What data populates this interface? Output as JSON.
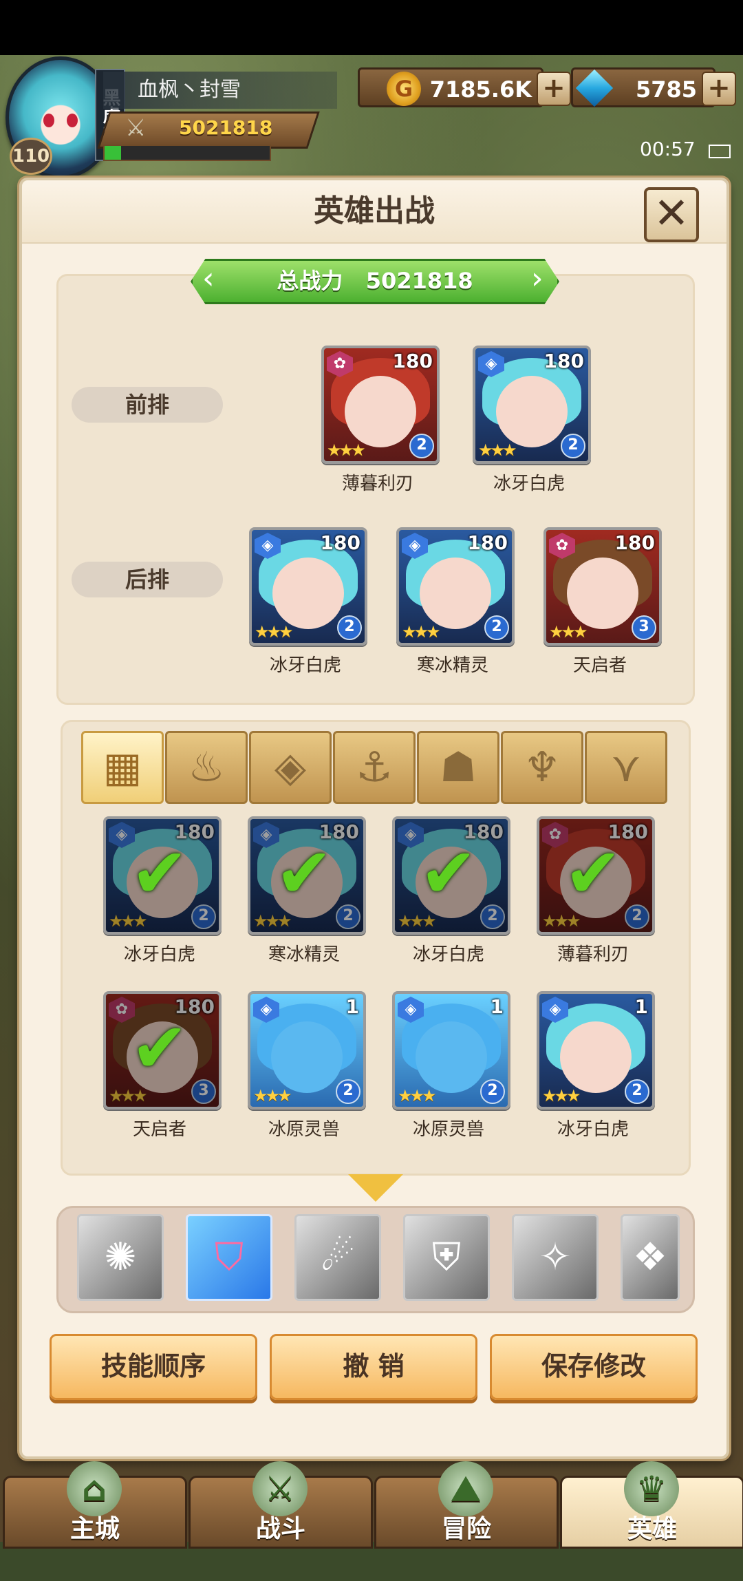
{
  "player": {
    "name": "血枫丶封雪",
    "level": "110",
    "power": "5021818",
    "vip_tag": "黑虎堂",
    "exp_fraction": 0.1
  },
  "currency": {
    "gold": "7185.6K",
    "gems": "5785"
  },
  "clock": "00:57",
  "panel": {
    "title": "英雄出战",
    "close_label": "✕",
    "total_power_label": "总战力",
    "total_power": "5021818",
    "front_row_label": "前排",
    "back_row_label": "后排"
  },
  "front_row": [
    {
      "name": "薄暮利刃",
      "level": "180",
      "rank": "2",
      "faction": "red"
    },
    {
      "name": "冰牙白虎",
      "level": "180",
      "rank": "2",
      "faction": "blue"
    }
  ],
  "back_row": [
    {
      "name": "冰牙白虎",
      "level": "180",
      "rank": "2",
      "faction": "blue"
    },
    {
      "name": "寒冰精灵",
      "level": "180",
      "rank": "2",
      "faction": "blue"
    },
    {
      "name": "天启者",
      "level": "180",
      "rank": "3",
      "faction": "red"
    }
  ],
  "filter_tabs": [
    {
      "icon": "grid-icon",
      "glyph": "▦",
      "active": true
    },
    {
      "icon": "flame-faction-icon",
      "glyph": "♨",
      "active": false
    },
    {
      "icon": "hex-faction-icon",
      "glyph": "◈",
      "active": false
    },
    {
      "icon": "anchor-icon",
      "glyph": "⚓",
      "active": false
    },
    {
      "icon": "beast-icon",
      "glyph": "☗",
      "active": false
    },
    {
      "icon": "demon-icon",
      "glyph": "♆",
      "active": false
    },
    {
      "icon": "wing-icon",
      "glyph": "⋎",
      "active": false
    }
  ],
  "roster": [
    {
      "name": "冰牙白虎",
      "level": "180",
      "rank": "2",
      "faction": "blue",
      "selected": true
    },
    {
      "name": "寒冰精灵",
      "level": "180",
      "rank": "2",
      "faction": "blue",
      "selected": true
    },
    {
      "name": "冰牙白虎",
      "level": "180",
      "rank": "2",
      "faction": "blue",
      "selected": true
    },
    {
      "name": "薄暮利刃",
      "level": "180",
      "rank": "2",
      "faction": "red",
      "selected": true
    },
    {
      "name": "天启者",
      "level": "180",
      "rank": "3",
      "faction": "red",
      "selected": true
    },
    {
      "name": "冰原灵兽",
      "level": "1",
      "rank": "2",
      "faction": "blue",
      "selected": false
    },
    {
      "name": "冰原灵兽",
      "level": "1",
      "rank": "2",
      "faction": "blue",
      "selected": false
    },
    {
      "name": "冰牙白虎",
      "level": "1",
      "rank": "2",
      "faction": "blue",
      "selected": false
    }
  ],
  "skills": [
    {
      "icon": "whirlwind-skill-icon",
      "glyph": "✺",
      "active": false
    },
    {
      "icon": "shield-skill-icon",
      "glyph": "⛉",
      "active": true
    },
    {
      "icon": "orb-skill-icon",
      "glyph": "☄",
      "active": false
    },
    {
      "icon": "crest-skill-icon",
      "glyph": "⛨",
      "active": false
    },
    {
      "icon": "vortex-skill-icon",
      "glyph": "✧",
      "active": false
    },
    {
      "icon": "blade-skill-icon",
      "glyph": "❖",
      "active": false
    }
  ],
  "buttons": {
    "skill_order": "技能顺序",
    "undo": "撤 销",
    "save": "保存修改"
  },
  "nav": [
    {
      "label": "主城",
      "icon": "castle-icon",
      "active": false
    },
    {
      "label": "战斗",
      "icon": "swords-icon",
      "active": false
    },
    {
      "label": "冒险",
      "icon": "adventurer-icon",
      "active": false
    },
    {
      "label": "英雄",
      "icon": "hero-icon",
      "active": true
    }
  ],
  "colors": {
    "faction_blue": "#3a7ae0",
    "faction_red": "#c03a6a",
    "accent_green": "#5dd020",
    "panel_bg": "#f9f0e2"
  }
}
